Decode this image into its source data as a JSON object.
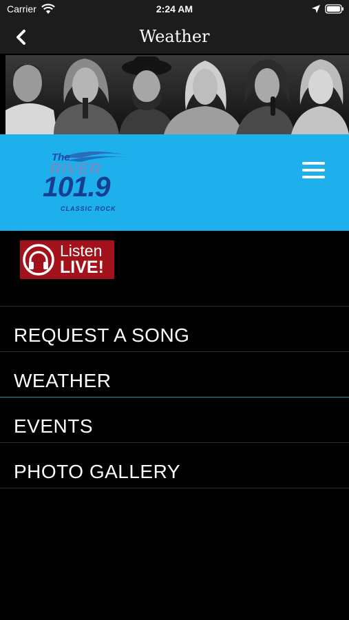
{
  "status_bar": {
    "carrier": "Carrier",
    "time": "2:24 AM",
    "icons": [
      "wifi-icon",
      "location-icon",
      "battery-icon"
    ]
  },
  "nav_bar": {
    "title": "Weather",
    "back_icon": "chevron-left-icon"
  },
  "banner": {
    "description_icon": "artist-portraits-image"
  },
  "header": {
    "logo": {
      "the": "The",
      "river": "RIVER",
      "frequency": "101.9",
      "tagline": "CLASSIC ROCK"
    },
    "menu_icon": "hamburger-menu-icon",
    "background_color": "#1eb0ec"
  },
  "listen_live": {
    "line1": "Listen",
    "line2": "LIVE!",
    "icon": "headphones-icon",
    "color": "#a3121a"
  },
  "menu": {
    "items": [
      {
        "label": "REQUEST A SONG"
      },
      {
        "label": "WEATHER"
      },
      {
        "label": "EVENTS"
      },
      {
        "label": "PHOTO GALLERY"
      }
    ],
    "active_index": 1,
    "active_color": "#2a8fa8"
  }
}
